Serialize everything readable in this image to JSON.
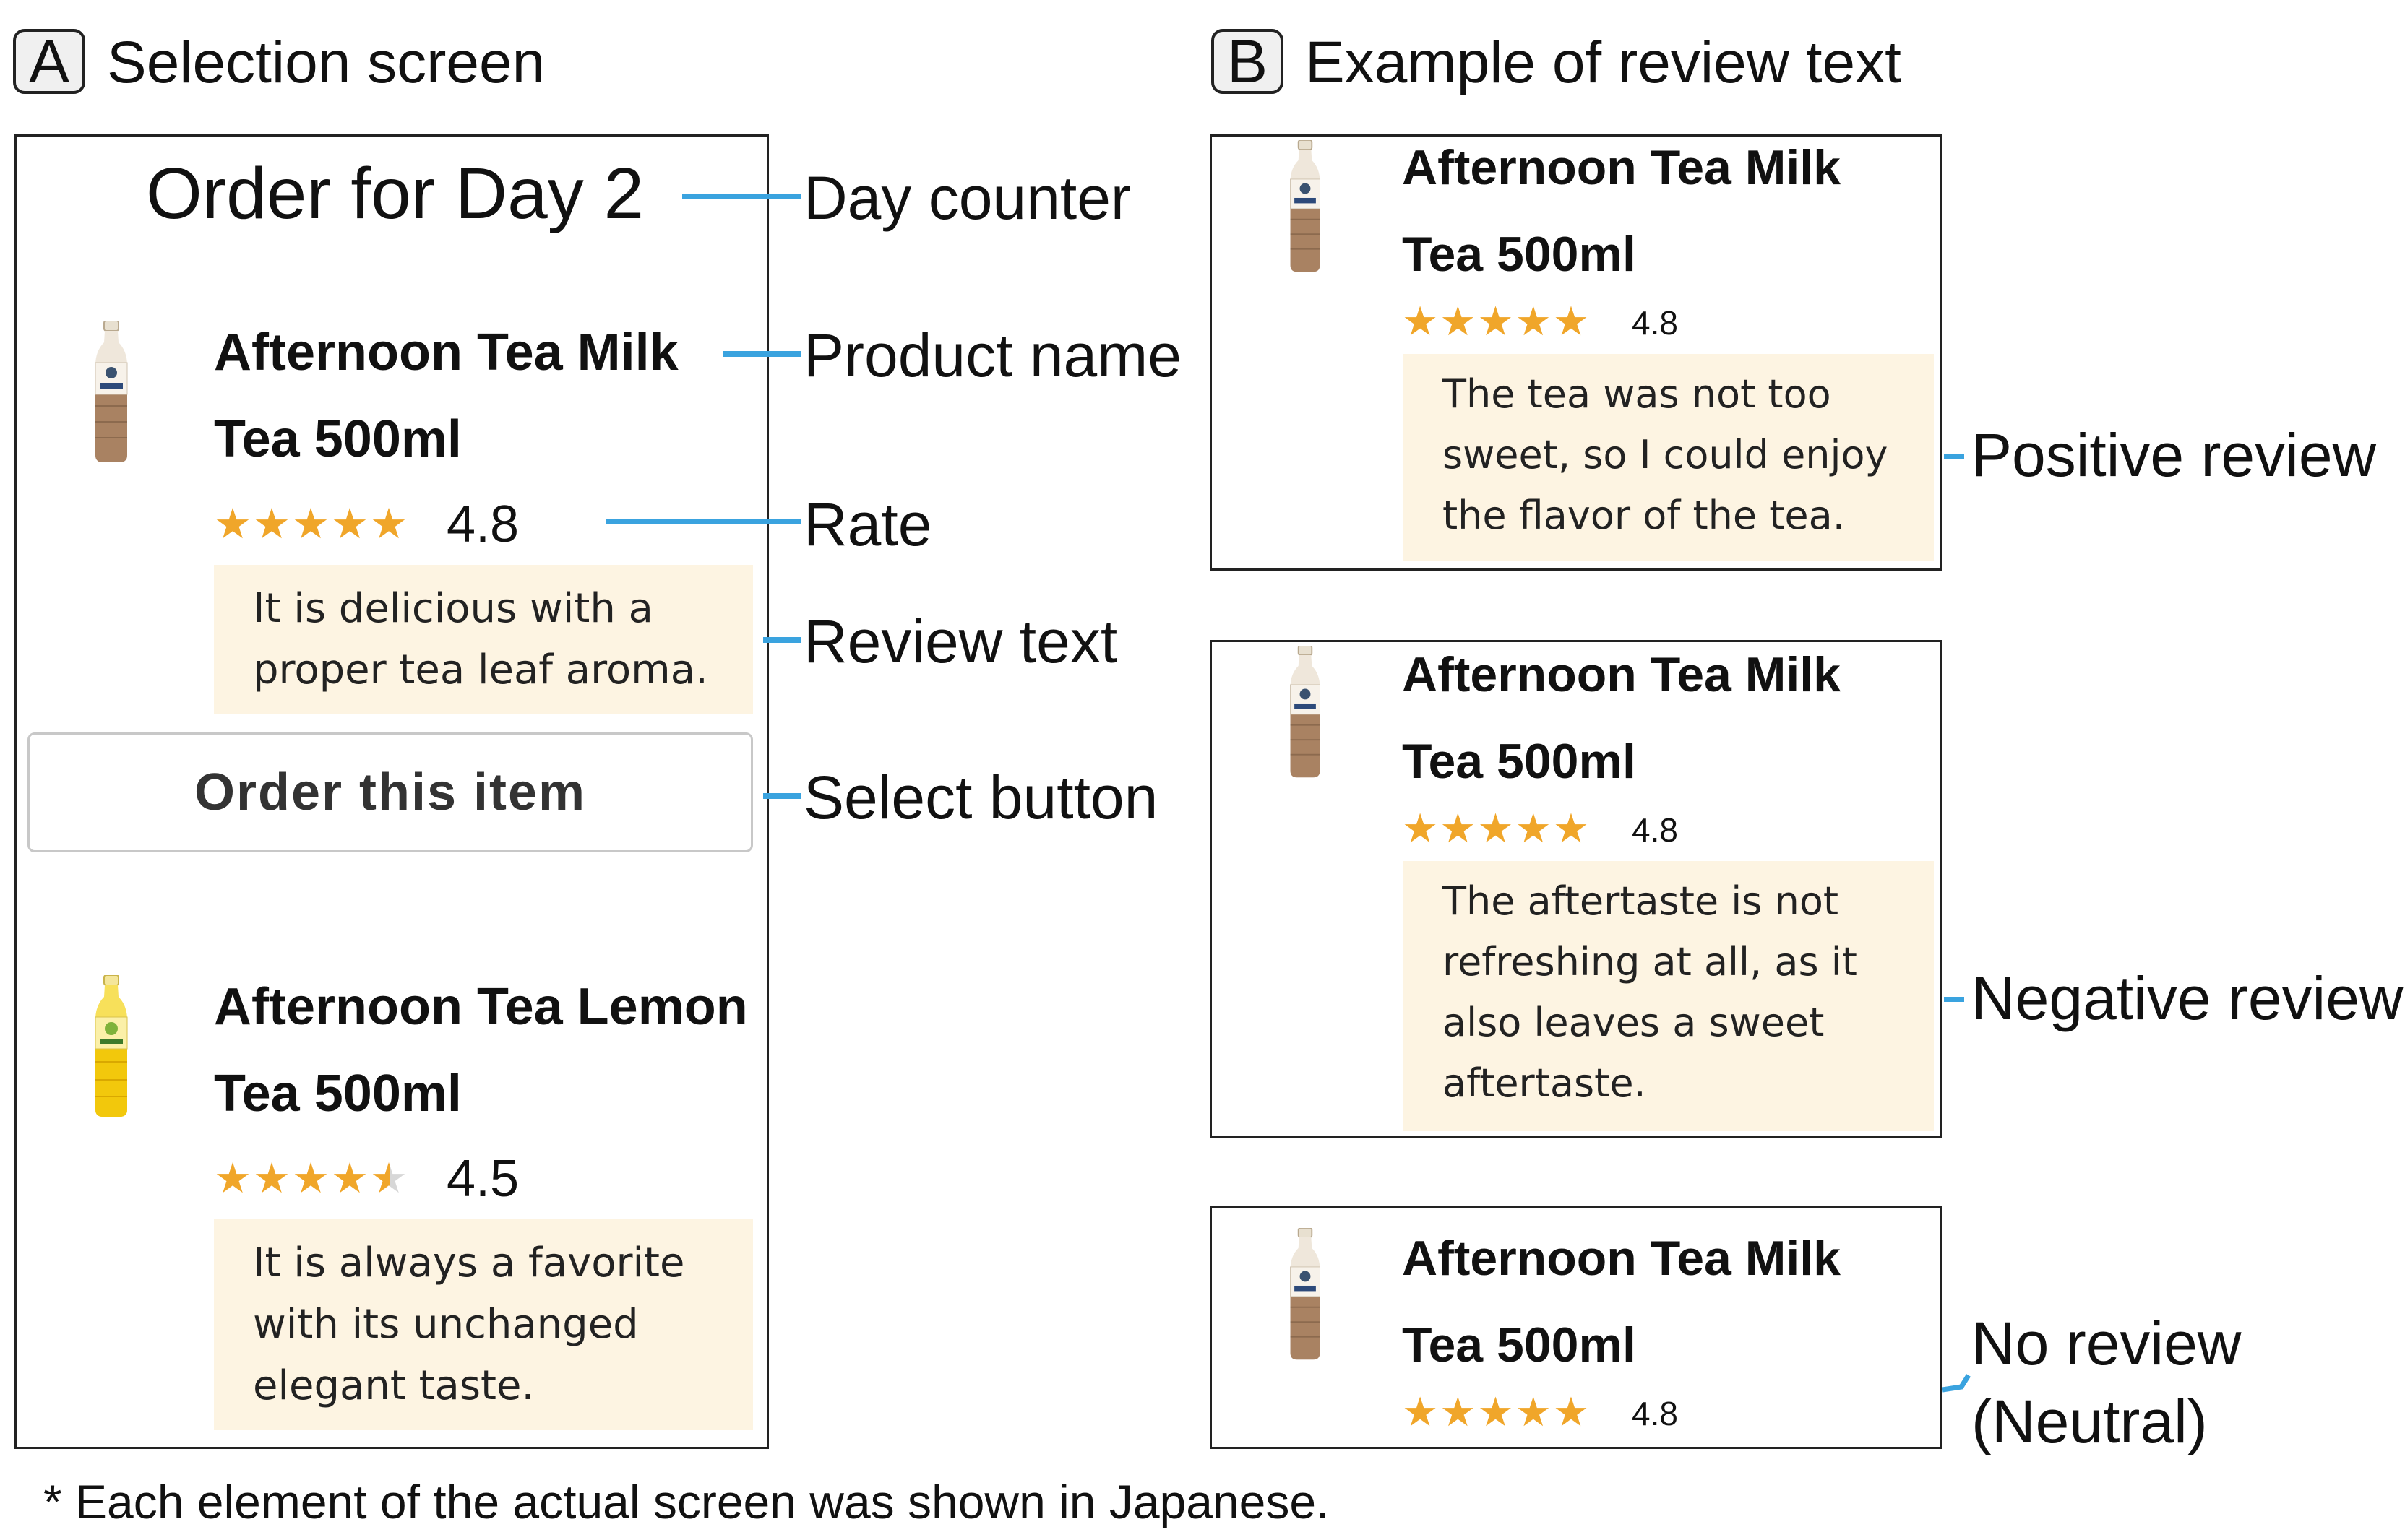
{
  "panel_a": {
    "letter": "A",
    "title": "Selection screen"
  },
  "panel_b": {
    "letter": "B",
    "title": "Example of review text"
  },
  "screen": {
    "day_counter": "Order for Day 2",
    "product1": {
      "name_line1": "Afternoon Tea Milk",
      "name_line2": "Tea 500ml",
      "stars": "★★★★★",
      "rating": "4.8",
      "review_line1": "It is delicious with a",
      "review_line2": "proper tea leaf aroma."
    },
    "order_button": "Order this item",
    "product2": {
      "name_line1": "Afternoon Tea Lemon",
      "name_line2": "Tea 500ml",
      "stars_full": "★★★★",
      "rating": "4.5",
      "review_line1": "It is always a favorite",
      "review_line2": "with its unchanged",
      "review_line3": "elegant taste."
    }
  },
  "callouts": {
    "day_counter": "Day counter",
    "product_name": "Product name",
    "rate": "Rate",
    "review_text": "Review text",
    "select_button": "Select button"
  },
  "examples": {
    "positive": {
      "name_line1": "Afternoon Tea Milk",
      "name_line2": "Tea 500ml",
      "stars": "★★★★★",
      "rating": "4.8",
      "review_line1": "The tea was not too",
      "review_line2": "sweet, so I could enjoy",
      "review_line3": "the flavor of the tea.",
      "label": "Positive review"
    },
    "negative": {
      "name_line1": "Afternoon Tea Milk",
      "name_line2": "Tea 500ml",
      "stars": "★★★★★",
      "rating": "4.8",
      "review_line1": "The aftertaste is not",
      "review_line2": "refreshing at all, as it",
      "review_line3": "also leaves a sweet",
      "review_line4": "aftertaste.",
      "label": "Negative review"
    },
    "neutral": {
      "name_line1": "Afternoon Tea Milk",
      "name_line2": "Tea 500ml",
      "stars": "★★★★★",
      "rating": "4.8",
      "label_line1": "No review",
      "label_line2": "(Neutral)"
    }
  },
  "footnote": "* Each element of the actual screen was shown in Japanese.",
  "colors": {
    "star": "#f0a62a",
    "review_bg": "#fdf4e2",
    "callout": "#3aa3df",
    "milk_tea": "#a98262",
    "lemon_tea": "#f2c80c"
  }
}
